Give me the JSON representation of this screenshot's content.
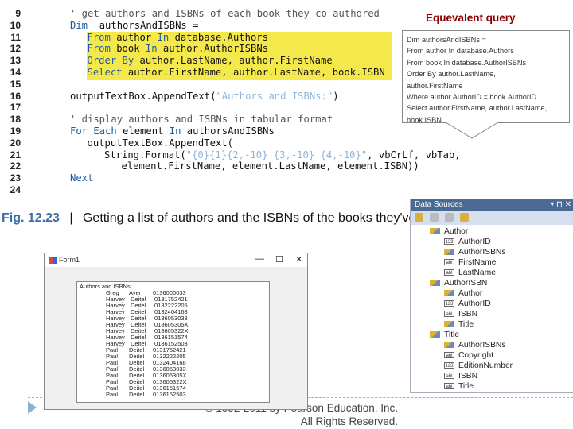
{
  "code": {
    "lines": [
      {
        "n": "9",
        "indent": 0,
        "parts": [
          [
            "cm",
            "' get authors and ISBNs of each book they co-authored"
          ]
        ]
      },
      {
        "n": "10",
        "indent": 0,
        "parts": [
          [
            "kw",
            "Dim"
          ],
          [
            "",
            "  authorsAndISBNs ="
          ]
        ]
      },
      {
        "n": "11",
        "indent": 1,
        "parts": [
          [
            "kw",
            "From"
          ],
          [
            "",
            " author "
          ],
          [
            "kw",
            "In"
          ],
          [
            "",
            " database.Authors"
          ]
        ]
      },
      {
        "n": "12",
        "indent": 1,
        "parts": [
          [
            "kw",
            "From"
          ],
          [
            "",
            " book "
          ],
          [
            "kw",
            "In"
          ],
          [
            "",
            " author.AuthorISBNs"
          ]
        ]
      },
      {
        "n": "13",
        "indent": 1,
        "parts": [
          [
            "kw",
            "Order By"
          ],
          [
            "",
            " author.LastName, author.FirstName"
          ]
        ]
      },
      {
        "n": "14",
        "indent": 1,
        "parts": [
          [
            "kw",
            "Select"
          ],
          [
            "",
            " author.FirstName, author.LastName, book.ISBN"
          ]
        ]
      },
      {
        "n": "15",
        "indent": 0,
        "parts": []
      },
      {
        "n": "16",
        "indent": 0,
        "parts": [
          [
            "",
            "outputTextBox.AppendText("
          ],
          [
            "st",
            "\"Authors and ISBNs:\""
          ],
          [
            "",
            ")"
          ]
        ]
      },
      {
        "n": "17",
        "indent": 0,
        "parts": []
      },
      {
        "n": "18",
        "indent": 0,
        "parts": [
          [
            "cm",
            "' display authors and ISBNs in tabular format"
          ]
        ]
      },
      {
        "n": "19",
        "indent": 0,
        "parts": [
          [
            "kw",
            "For Each"
          ],
          [
            "",
            " element "
          ],
          [
            "kw",
            "In"
          ],
          [
            "",
            " authorsAndISBNs"
          ]
        ]
      },
      {
        "n": "20",
        "indent": 1,
        "parts": [
          [
            "",
            "outputTextBox.AppendText("
          ]
        ]
      },
      {
        "n": "21",
        "indent": 2,
        "parts": [
          [
            "",
            "String.Format("
          ],
          [
            "st",
            "\"{0}{1}{2,-10} {3,-10} {4,-10}\""
          ],
          [
            "",
            ", vbCrLf, vbTab,"
          ]
        ]
      },
      {
        "n": "22",
        "indent": 3,
        "parts": [
          [
            "",
            "element.FirstName, element.LastName, element.ISBN))"
          ]
        ]
      },
      {
        "n": "23",
        "indent": 0,
        "parts": [
          [
            "kw",
            "Next"
          ]
        ]
      },
      {
        "n": "24",
        "indent": 0,
        "parts": []
      }
    ]
  },
  "callout": {
    "title": "Equevalent query",
    "lines": [
      "Dim authorsAndISBNs =",
      "From author In database.Authors",
      "From book In database.AuthorISBNs",
      "Order By author.LastName,",
      "author.FirstName",
      "Where author.AuthorID = book.AuthorID",
      "Select author.FirstName, author.LastName,",
      "book.ISBN"
    ]
  },
  "caption": {
    "fig": "Fig. 12.23",
    "sep": "|",
    "text": "Getting a list of authors and the ISBNs of the books they've authored."
  },
  "form": {
    "title": "Form1",
    "min": "—",
    "max": "☐",
    "close": "✕",
    "header": "Authors and ISBNs:",
    "rows": [
      [
        "Greg",
        "Ayer",
        "0136000033"
      ],
      [
        "Harvey",
        "Deitel",
        "0131752421"
      ],
      [
        "Harvey",
        "Deitel",
        "0132222205"
      ],
      [
        "Harvey",
        "Deitel",
        "0132404168"
      ],
      [
        "Harvey",
        "Deitel",
        "0136053033"
      ],
      [
        "Harvey",
        "Deitel",
        "013605305X"
      ],
      [
        "Harvey",
        "Deitel",
        "013605322X"
      ],
      [
        "Harvey",
        "Deitel",
        "0136151574"
      ],
      [
        "Harvey",
        "Deitel",
        "0136152503"
      ],
      [
        "Paul",
        "Deitel",
        "0131752421"
      ],
      [
        "Paul",
        "Deitel",
        "0132222205"
      ],
      [
        "Paul",
        "Deitel",
        "0132404168"
      ],
      [
        "Paul",
        "Deitel",
        "0136053033"
      ],
      [
        "Paul",
        "Deitel",
        "013605305X"
      ],
      [
        "Paul",
        "Deitel",
        "013605322X"
      ],
      [
        "Paul",
        "Deitel",
        "0136151574"
      ],
      [
        "Paul",
        "Deitel",
        "0136152503"
      ]
    ]
  },
  "copyright": {
    "line1": "© 1992-2011 by Pearson Education, Inc.",
    "line2": "All Rights Reserved."
  },
  "datasources": {
    "title": "Data Sources",
    "controls": "▾ ⊓ ✕",
    "tree": [
      {
        "level": 0,
        "icon": "rel",
        "label": "Author"
      },
      {
        "level": 1,
        "icon": "123",
        "label": "AuthorID"
      },
      {
        "level": 1,
        "icon": "rel",
        "label": "AuthorISBNs"
      },
      {
        "level": 1,
        "icon": "abl",
        "label": "FirstName"
      },
      {
        "level": 1,
        "icon": "abl",
        "label": "LastName"
      },
      {
        "level": 0,
        "icon": "rel",
        "label": "AuthorISBN"
      },
      {
        "level": 1,
        "icon": "rel",
        "label": "Author"
      },
      {
        "level": 1,
        "icon": "123",
        "label": "AuthorID"
      },
      {
        "level": 1,
        "icon": "abl",
        "label": "ISBN"
      },
      {
        "level": 1,
        "icon": "rel",
        "label": "Title"
      },
      {
        "level": 0,
        "icon": "rel",
        "label": "Title"
      },
      {
        "level": 1,
        "icon": "rel",
        "label": "AuthorISBNs"
      },
      {
        "level": 1,
        "icon": "abl",
        "label": "Copyright"
      },
      {
        "level": 1,
        "icon": "123",
        "label": "EditionNumber"
      },
      {
        "level": 1,
        "icon": "abl",
        "label": "ISBN"
      },
      {
        "level": 1,
        "icon": "abl",
        "label": "Title"
      }
    ]
  }
}
